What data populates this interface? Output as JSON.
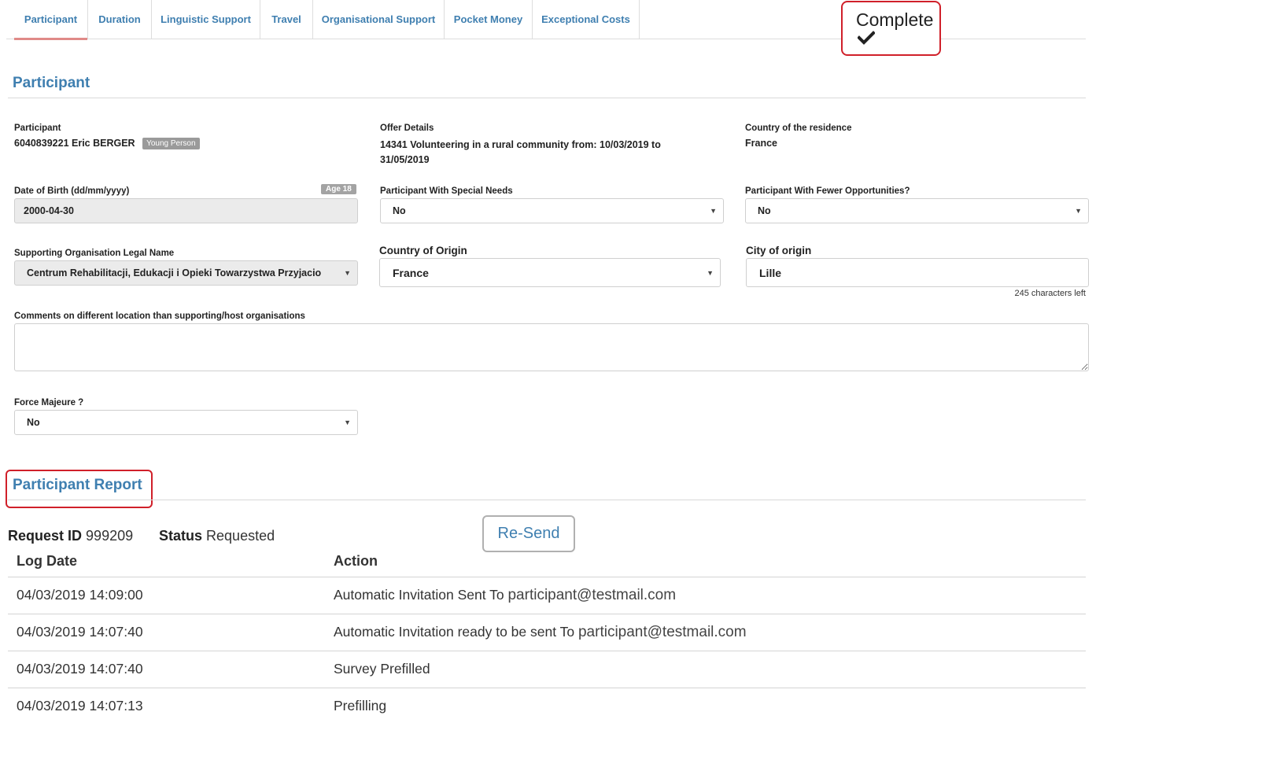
{
  "tabs": [
    {
      "label": "Participant",
      "active": true
    },
    {
      "label": "Duration"
    },
    {
      "label": "Linguistic Support"
    },
    {
      "label": "Travel"
    },
    {
      "label": "Organisational Support"
    },
    {
      "label": "Pocket Money"
    },
    {
      "label": "Exceptional Costs"
    }
  ],
  "complete": {
    "label": "Complete",
    "icon": "checkmark-icon"
  },
  "participant_section": {
    "title": "Participant",
    "participant": {
      "label": "Participant",
      "value": "6040839221 Eric BERGER",
      "badge": "Young Person"
    },
    "offer": {
      "label": "Offer Details",
      "value_line1": "14341 Volunteering in a rural community from: 10/03/2019 to",
      "value_line2": "31/05/2019"
    },
    "residence": {
      "label": "Country of the residence",
      "value": "France"
    },
    "dob": {
      "label": "Date of Birth (dd/mm/yyyy)",
      "badge": "Age 18",
      "value": "2000-04-30"
    },
    "special_needs": {
      "label": "Participant With Special Needs",
      "value": "No"
    },
    "fewer_opportunities": {
      "label": "Participant With Fewer Opportunities?",
      "value": "No"
    },
    "supporting_org": {
      "label": "Supporting Organisation Legal Name",
      "value": "Centrum Rehabilitacji, Edukacji i Opieki Towarzystwa Przyjacio"
    },
    "country_origin": {
      "label": "Country of Origin",
      "value": "France"
    },
    "city_origin": {
      "label": "City of origin",
      "value": "Lille",
      "chars_left": "245 characters left"
    },
    "comments": {
      "label": "Comments on different location than supporting/host organisations",
      "value": ""
    },
    "force_majeure": {
      "label": "Force Majeure ?",
      "value": "No"
    }
  },
  "report_section": {
    "title": "Participant Report",
    "request_id_label": "Request ID",
    "request_id": "999209",
    "status_label": "Status",
    "status": "Requested",
    "resend_label": "Re-Send",
    "columns": [
      "Log Date",
      "Action"
    ],
    "rows": [
      {
        "date": "04/03/2019 14:09:00",
        "action": "Automatic Invitation Sent To",
        "email": "participant@testmail.com"
      },
      {
        "date": "04/03/2019 14:07:40",
        "action": "Automatic Invitation ready to be sent To",
        "email": "participant@testmail.com"
      },
      {
        "date": "04/03/2019 14:07:40",
        "action": "Survey Prefilled",
        "email": ""
      },
      {
        "date": "04/03/2019 14:07:13",
        "action": "Prefilling",
        "email": ""
      }
    ]
  },
  "colors": {
    "accent": "#3f7fb0",
    "highlight": "#d0202a",
    "tab_underline": "#e08a88"
  }
}
